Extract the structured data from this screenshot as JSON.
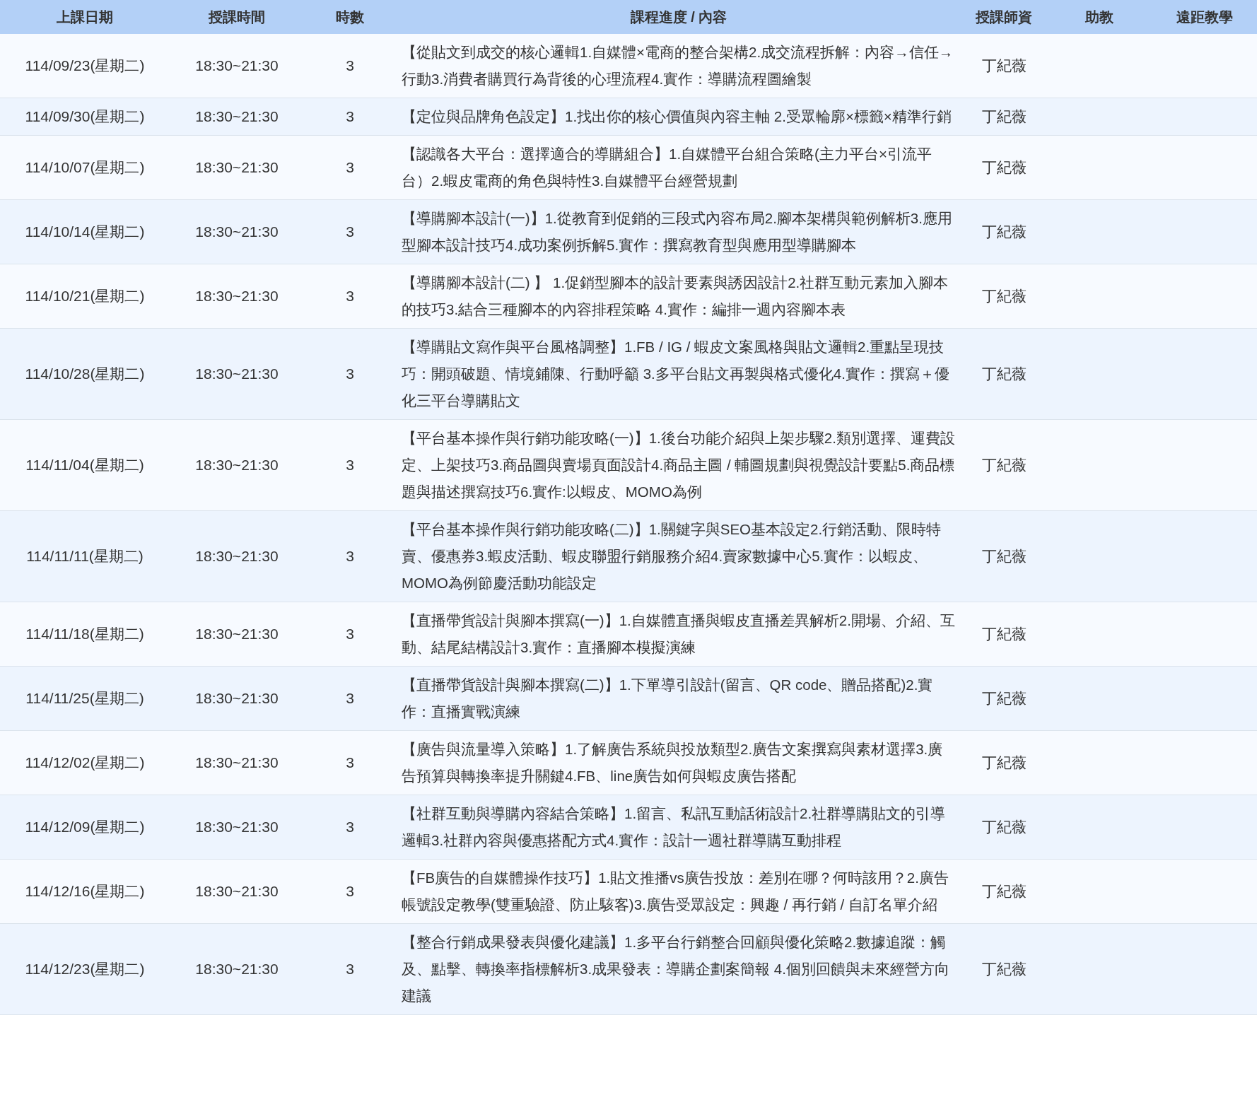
{
  "table": {
    "columns": [
      "上課日期",
      "授課時間",
      "時數",
      "課程進度 / 內容",
      "授課師資",
      "助教",
      "遠距教學"
    ],
    "rows": [
      {
        "date": "114/09/23(星期二)",
        "time": "18:30~21:30",
        "hours": "3",
        "content": "【從貼文到成交的核心邏輯1.自媒體×電商的整合架構2.成交流程拆解：內容→信任→行動3.消費者購買行為背後的心理流程4.實作：導購流程圖繪製",
        "teacher": "丁紀薇"
      },
      {
        "date": "114/09/30(星期二)",
        "time": "18:30~21:30",
        "hours": "3",
        "content": "【定位與品牌角色設定】1.找出你的核心價值與內容主軸 2.受眾輪廓×標籤×精準行銷",
        "teacher": "丁紀薇"
      },
      {
        "date": "114/10/07(星期二)",
        "time": "18:30~21:30",
        "hours": "3",
        "content": "【認識各大平台：選擇適合的導購組合】1.自媒體平台組合策略(主力平台×引流平台）2.蝦皮電商的角色與特性3.自媒體平台經營規劃",
        "teacher": "丁紀薇"
      },
      {
        "date": "114/10/14(星期二)",
        "time": "18:30~21:30",
        "hours": "3",
        "content": "【導購腳本設計(一)】1.從教育到促銷的三段式內容布局2.腳本架構與範例解析3.應用型腳本設計技巧4.成功案例拆解5.實作：撰寫教育型與應用型導購腳本",
        "teacher": "丁紀薇"
      },
      {
        "date": "114/10/21(星期二)",
        "time": "18:30~21:30",
        "hours": "3",
        "content": "【導購腳本設計(二) 】 1.促銷型腳本的設計要素與誘因設計2.社群互動元素加入腳本的技巧3.結合三種腳本的內容排程策略 4.實作：編排一週內容腳本表",
        "teacher": "丁紀薇"
      },
      {
        "date": "114/10/28(星期二)",
        "time": "18:30~21:30",
        "hours": "3",
        "content": "【導購貼文寫作與平台風格調整】1.FB / IG / 蝦皮文案風格與貼文邏輯2.重點呈現技巧：開頭破題、情境鋪陳、行動呼籲 3.多平台貼文再製與格式優化4.實作：撰寫＋優化三平台導購貼文",
        "teacher": "丁紀薇"
      },
      {
        "date": "114/11/04(星期二)",
        "time": "18:30~21:30",
        "hours": "3",
        "content": "【平台基本操作與行銷功能攻略(一)】1.後台功能介紹與上架步驟2.類別選擇、運費設定、上架技巧3.商品圖與賣場頁面設計4.商品主圖 / 輔圖規劃與視覺設計要點5.商品標題與描述撰寫技巧6.實作:以蝦皮、MOMO為例",
        "teacher": "丁紀薇"
      },
      {
        "date": "114/11/11(星期二)",
        "time": "18:30~21:30",
        "hours": "3",
        "content": "【平台基本操作與行銷功能攻略(二)】1.關鍵字與SEO基本設定2.行銷活動、限時特賣、優惠券3.蝦皮活動、蝦皮聯盟行銷服務介紹4.賣家數據中心5.實作：以蝦皮、MOMO為例節慶活動功能設定",
        "teacher": "丁紀薇"
      },
      {
        "date": "114/11/18(星期二)",
        "time": "18:30~21:30",
        "hours": "3",
        "content": "【直播帶貨設計與腳本撰寫(一)】1.自媒體直播與蝦皮直播差異解析2.開場、介紹、互動、結尾結構設計3.實作：直播腳本模擬演練",
        "teacher": "丁紀薇"
      },
      {
        "date": "114/11/25(星期二)",
        "time": "18:30~21:30",
        "hours": "3",
        "content": "【直播帶貨設計與腳本撰寫(二)】1.下單導引設計(留言、QR code、贈品搭配)2.實作：直播實戰演練",
        "teacher": "丁紀薇"
      },
      {
        "date": "114/12/02(星期二)",
        "time": "18:30~21:30",
        "hours": "3",
        "content": "【廣告與流量導入策略】1.了解廣告系統與投放類型2.廣告文案撰寫與素材選擇3.廣告預算與轉換率提升關鍵4.FB、line廣告如何與蝦皮廣告搭配",
        "teacher": "丁紀薇"
      },
      {
        "date": "114/12/09(星期二)",
        "time": "18:30~21:30",
        "hours": "3",
        "content": "【社群互動與導購內容結合策略】1.留言、私訊互動話術設計2.社群導購貼文的引導邏輯3.社群內容與優惠搭配方式4.實作：設計一週社群導購互動排程",
        "teacher": "丁紀薇"
      },
      {
        "date": "114/12/16(星期二)",
        "time": "18:30~21:30",
        "hours": "3",
        "content": "【FB廣告的自媒體操作技巧】1.貼文推播vs廣告投放：差別在哪？何時該用？2.廣告帳號設定教學(雙重驗證、防止駭客)3.廣告受眾設定：興趣 / 再行銷 / 自訂名單介紹",
        "teacher": "丁紀薇"
      },
      {
        "date": "114/12/23(星期二)",
        "time": "18:30~21:30",
        "hours": "3",
        "content": "【整合行銷成果發表與優化建議】1.多平台行銷整合回顧與優化策略2.數據追蹤：觸及、點擊、轉換率指標解析3.成果發表：導購企劃案簡報 4.個別回饋與未來經營方向建議",
        "teacher": "丁紀薇"
      }
    ]
  }
}
